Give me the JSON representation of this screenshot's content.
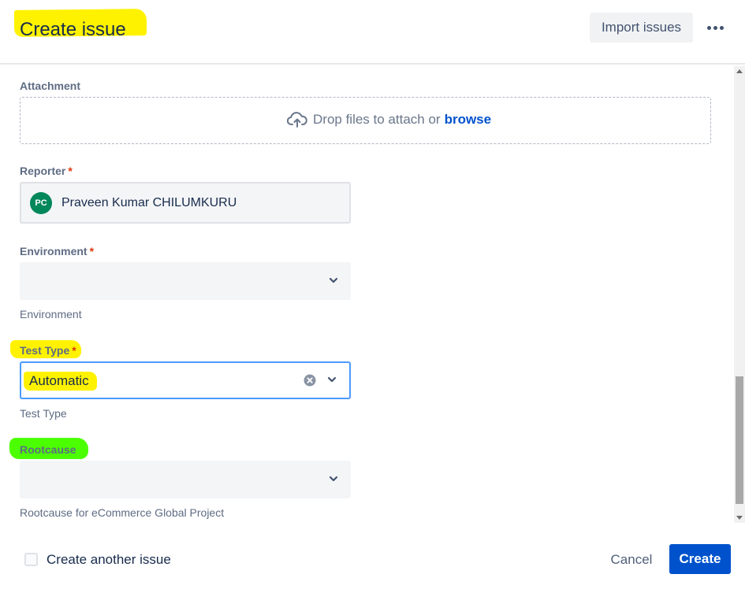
{
  "header": {
    "title": "Create issue",
    "import_label": "Import issues",
    "more_icon": "more-horizontal-icon"
  },
  "attachment": {
    "label": "Attachment",
    "drop_text": "Drop files to attach or",
    "browse_label": "browse",
    "icon": "cloud-upload-icon"
  },
  "reporter": {
    "label": "Reporter",
    "required_mark": "*",
    "avatar_initials": "PC",
    "name": "Praveen Kumar CHILUMKURU",
    "avatar_color": "#00875a"
  },
  "environment": {
    "label": "Environment",
    "required_mark": "*",
    "value": "",
    "helper": "Environment"
  },
  "test_type": {
    "label": "Test Type",
    "required_mark": "*",
    "value": "Automatic",
    "helper": "Test Type"
  },
  "rootcause": {
    "label": "Rootcause",
    "value": "",
    "helper": "Rootcause for eCommerce Global Project"
  },
  "footer": {
    "create_another_label": "Create another issue",
    "create_another_checked": false,
    "cancel_label": "Cancel",
    "create_label": "Create"
  },
  "colors": {
    "primary": "#0052cc",
    "required": "#de350b",
    "focus_border": "#4c9aff",
    "highlight_yellow": "#fff200",
    "highlight_green": "#4cff00"
  }
}
